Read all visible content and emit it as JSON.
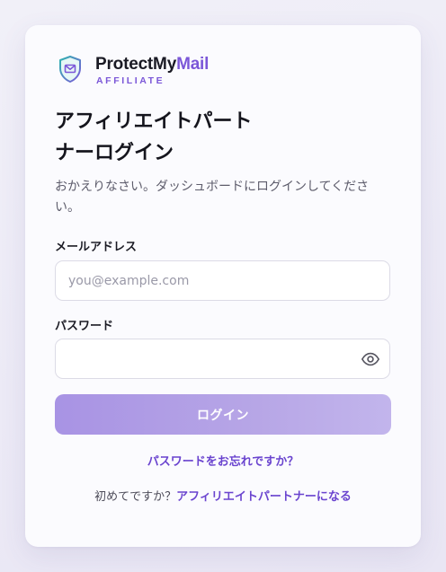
{
  "brand": {
    "name_primary": "ProtectMy",
    "name_accent": "Mail",
    "subtitle": "AFFILIATE",
    "icon": "shield-mail-icon"
  },
  "login": {
    "title": "アフィリエイトパートナーログイン",
    "subtitle": "おかえりなさい。ダッシュボードにログインしてください。"
  },
  "form": {
    "email_label": "メールアドレス",
    "email_placeholder": "you@example.com",
    "email_value": "",
    "password_label": "パスワード",
    "password_value": "",
    "show_password_icon": "eye-icon",
    "submit_label": "ログイン"
  },
  "links": {
    "forgot_password": "パスワードをお忘れですか？",
    "signup_prompt": "初めてですか？",
    "signup_link": "アフィリエイトパートナーになる"
  },
  "colors": {
    "accent": "#7b57d8",
    "link": "#6a44cf",
    "button_gradient_start": "#a893e4",
    "button_gradient_end": "#c2b5ec",
    "icon_teal": "#2fb4b0"
  }
}
